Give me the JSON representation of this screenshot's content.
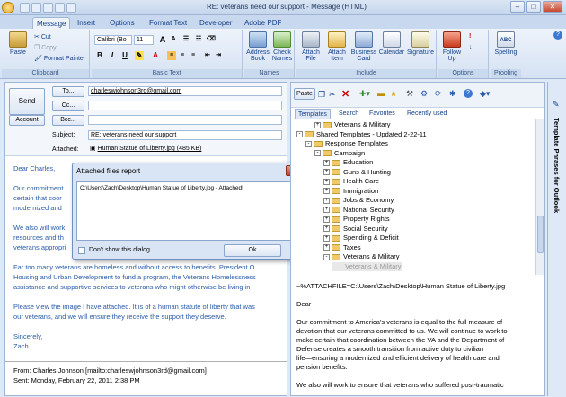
{
  "window": {
    "title": "RE: veterans need our support - Message (HTML)",
    "min": "–",
    "max": "□",
    "close": "✕"
  },
  "tabs": [
    "Message",
    "Insert",
    "Options",
    "Format Text",
    "Developer",
    "Adobe PDF"
  ],
  "ribbon": {
    "clipboard": {
      "label": "Clipboard",
      "paste": "Paste",
      "cut": "Cut",
      "copy": "Copy",
      "format_painter": "Format Painter"
    },
    "basic_text": {
      "label": "Basic Text",
      "font": "Calibri (Bo",
      "size": "11"
    },
    "names": {
      "label": "Names",
      "address_book": "Address Book",
      "check_names": "Check Names"
    },
    "include": {
      "label": "Include",
      "attach_file": "Attach File",
      "attach_item": "Attach Item",
      "business_card": "Business Card",
      "calendar": "Calendar",
      "signature": "Signature"
    },
    "options": {
      "label": "Options",
      "follow_up": "Follow Up"
    },
    "proofing": {
      "label": "Proofing",
      "spelling": "Spelling"
    }
  },
  "compose": {
    "send": "Send",
    "to_btn": "To...",
    "cc_btn": "Cc...",
    "bcc_btn": "Bcc...",
    "account_btn": "Account",
    "to_value": "charleswjohnson3rd@gmail.com",
    "subject_label": "Subject:",
    "subject_value": "RE: veterans need our support",
    "attached_label": "Attached:",
    "attached_value": "Human Statue of Liberty.jpg (485 KB)",
    "body": [
      "Dear Charles,",
      "",
      "Our commitment",
      "certain that coor",
      "modernized and",
      "",
      "We also will work",
      "resources and th",
      "veterans appropri",
      "",
      "Far too many veterans are homeless and without access to benefits. President O",
      "Housing and Urban Development to fund a program, the Veterans Homelessness",
      "assistance and supportive services to veterans who might otherwise be living in",
      "",
      "Please view the image I have attached. It is of a human statute of liberty that was",
      "our veterans, and we will ensure they receive the support they deserve.",
      "",
      "Sincerely,",
      "Zach"
    ],
    "from_line": "From: Charles Johnson [mailto:charleswjohnson3rd@gmail.com]",
    "sent_line": "Sent: Monday, February 22, 2011 2:38 PM"
  },
  "dialog": {
    "title": "Attached files report",
    "message": "C:\\Users\\Zach\\Desktop\\Human Statue of Liberty.jpg - Attached!",
    "checkbox_label": "Don't show this dialog",
    "ok": "Ok"
  },
  "pane": {
    "paste": "Paste",
    "tabs": [
      "Templates",
      "Search",
      "Favorites",
      "Recently used"
    ],
    "tree": [
      {
        "label": "Veterans & Military",
        "indent": 2,
        "expander": "+",
        "folder": true
      },
      {
        "label": "Shared Templates - Updated 2-22-11",
        "indent": 0,
        "expander": "-",
        "folder": true
      },
      {
        "label": "Response Templates",
        "indent": 1,
        "expander": "-",
        "folder": true
      },
      {
        "label": "Campaign",
        "indent": 2,
        "expander": "-",
        "folder": true
      },
      {
        "label": "Education",
        "indent": 3,
        "expander": "+",
        "folder": true
      },
      {
        "label": "Guns & Hunting",
        "indent": 3,
        "expander": "+",
        "folder": true
      },
      {
        "label": "Health Care",
        "indent": 3,
        "expander": "+",
        "folder": true
      },
      {
        "label": "Immigration",
        "indent": 3,
        "expander": "+",
        "folder": true
      },
      {
        "label": "Jobs & Economy",
        "indent": 3,
        "expander": "+",
        "folder": true
      },
      {
        "label": "National Security",
        "indent": 3,
        "expander": "+",
        "folder": true
      },
      {
        "label": "Property Rights",
        "indent": 3,
        "expander": "+",
        "folder": true
      },
      {
        "label": "Social Security",
        "indent": 3,
        "expander": "+",
        "folder": true
      },
      {
        "label": "Spending & Deficit",
        "indent": 3,
        "expander": "+",
        "folder": true
      },
      {
        "label": "Taxes",
        "indent": 3,
        "expander": "+",
        "folder": true
      },
      {
        "label": "Veterans & Military",
        "indent": 3,
        "expander": "-",
        "folder": true
      },
      {
        "label": "Veterans & Military",
        "indent": 4,
        "expander": "",
        "folder": false,
        "selected": true
      }
    ],
    "preview": [
      "~%ATTACHFILE=C:\\Users\\Zach\\Desktop\\Human Statue of Liberty.jpg",
      "",
      "Dear",
      "",
      "Our commitment to America's veterans is equal to the full measure of",
      "devotion that our veterans committed to us. We will continue to work to",
      "make certain that coordination between the VA and the Department of",
      "Defense creates a smooth transition from active duty to civilian",
      "life—ensuring a modernized and efficient delivery of health care and",
      "pension benefits.",
      "",
      "We also will work to ensure that veterans who suffered post-traumatic"
    ]
  },
  "sidebar": {
    "title": "Template Phrases for Outlook"
  }
}
